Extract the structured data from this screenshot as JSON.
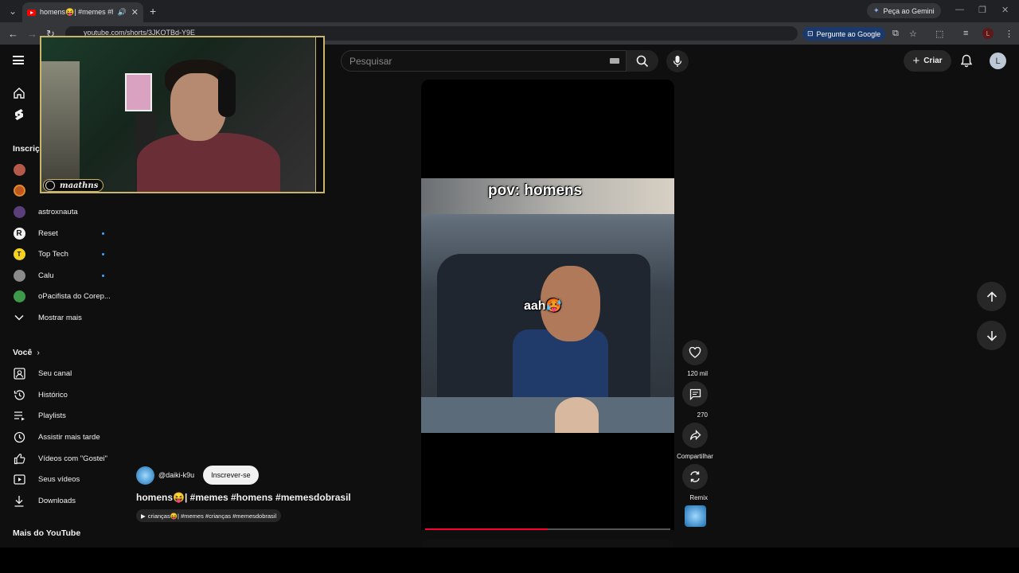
{
  "browser": {
    "tab_title": "homens😝| #memes #hom",
    "gemini_label": "Peça ao Gemini",
    "url": "youtube.com/shorts/3JKOTBd-Y9E",
    "google_label": "Pergunte ao Google",
    "profile_letter": "L"
  },
  "header": {
    "search_placeholder": "Pesquisar",
    "create_label": "Criar",
    "account_letter": "L"
  },
  "sidebar": {
    "subs_heading": "Inscriç",
    "subscriptions": [
      {
        "name": "astroxnauta",
        "color": "#5a3f7a",
        "new": false
      },
      {
        "name": "Reset",
        "color": "#f1f1f1",
        "new": true
      },
      {
        "name": "Top Tech",
        "color": "#f4d21f",
        "new": true
      },
      {
        "name": "Calu",
        "color": "#8a8a8a",
        "new": true
      },
      {
        "name": "oPacifista do Corep...",
        "color": "#3e9a4a",
        "new": false
      }
    ],
    "show_more": "Mostrar mais",
    "you_heading": "Você",
    "you_items": [
      "Seu canal",
      "Histórico",
      "Playlists",
      "Assistir mais tarde",
      "Vídeos com \"Gostei\"",
      "Seus vídeos",
      "Downloads"
    ],
    "more_heading": "Mais do YouTube"
  },
  "overlay": {
    "streamer_tag": "maathns"
  },
  "short": {
    "caption_top": "pov: homens",
    "caption_mid": "aah🥵",
    "progress": 0.5,
    "channel_handle": "@daiki-k9u",
    "subscribe_label": "Inscrever-se",
    "title": "homens😝| #memes #homens #memesdobrasil",
    "chip_label": "crianças😝| #memes #crianças #memesdobrasil",
    "actions": {
      "likes": "120 mil",
      "comments": "270",
      "share": "Compartilhar",
      "remix": "Remix"
    }
  }
}
